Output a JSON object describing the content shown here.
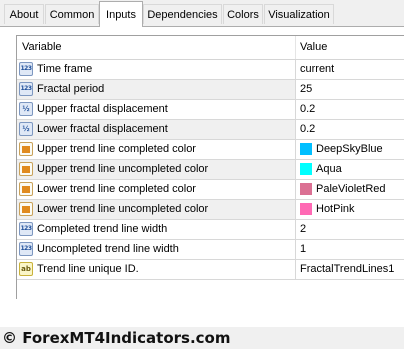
{
  "tabs": [
    {
      "label": "About"
    },
    {
      "label": "Common"
    },
    {
      "label": "Inputs"
    },
    {
      "label": "Dependencies"
    },
    {
      "label": "Colors"
    },
    {
      "label": "Visualization"
    }
  ],
  "active_tab": "Inputs",
  "grid": {
    "headers": {
      "variable": "Variable",
      "value": "Value"
    },
    "rows": [
      {
        "type": "int",
        "icon": "integer-icon",
        "icon_text": "123",
        "name": "Time frame",
        "value": "current"
      },
      {
        "type": "int",
        "icon": "integer-icon",
        "icon_text": "123",
        "name": "Fractal period",
        "value": "25"
      },
      {
        "type": "double",
        "icon": "double-icon",
        "icon_text": "½",
        "name": "Upper fractal displacement",
        "value": "0.2"
      },
      {
        "type": "double",
        "icon": "double-icon",
        "icon_text": "½",
        "name": "Lower fractal displacement",
        "value": "0.2"
      },
      {
        "type": "color",
        "icon": "color-icon",
        "name": "Upper trend line completed color",
        "value": "DeepSkyBlue",
        "swatch": "#00bfff"
      },
      {
        "type": "color",
        "icon": "color-icon",
        "name": "Upper trend line uncompleted color",
        "value": "Aqua",
        "swatch": "#00ffff"
      },
      {
        "type": "color",
        "icon": "color-icon",
        "name": "Lower trend line completed color",
        "value": "PaleVioletRed",
        "swatch": "#db7093"
      },
      {
        "type": "color",
        "icon": "color-icon",
        "name": "Lower trend line uncompleted color",
        "value": "HotPink",
        "swatch": "#ff69b4"
      },
      {
        "type": "int",
        "icon": "integer-icon",
        "icon_text": "123",
        "name": "Completed trend line width",
        "value": "2"
      },
      {
        "type": "int",
        "icon": "integer-icon",
        "icon_text": "123",
        "name": "Uncompleted trend line width",
        "value": "1"
      },
      {
        "type": "string",
        "icon": "string-icon",
        "icon_text": "ab",
        "name": "Trend line unique ID.",
        "value": "FractalTrendLines1"
      }
    ]
  },
  "footer": {
    "copyright": "© ForexMT4Indicators.com"
  }
}
